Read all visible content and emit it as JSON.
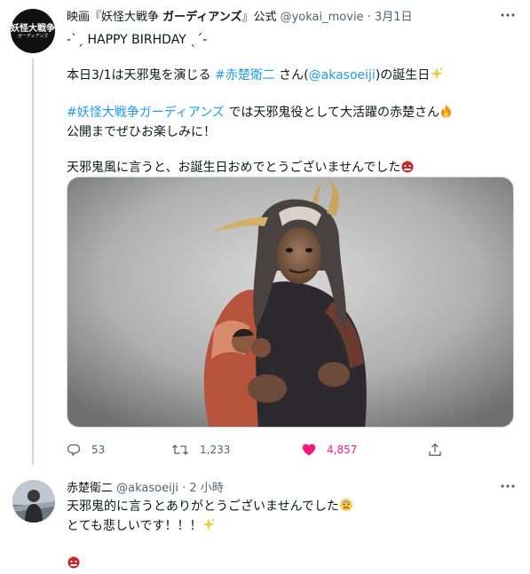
{
  "tweet": {
    "avatar_text": "妖怪大戦争",
    "avatar_subtext": "ガーディアンズ",
    "name_prefix": "映画『妖怪大戦争 ",
    "name_bold": "ガーディアンズ",
    "name_suffix": "』公式",
    "handle": "@yokai_movie",
    "separator": "·",
    "date": "3月1日",
    "line1": "-ˋˏ HAPPY BIRHDAY ˎˊ-",
    "line2_prefix": "本日3/1は天邪鬼を演じる ",
    "line2_hashtag": "#赤楚衛二",
    "line2_mid": " さん(",
    "line2_mention": "@akasoeiji",
    "line2_suffix": ")の誕生日",
    "line3_hashtag": "#妖怪大戦争ガーディアンズ",
    "line3_suffix": " では天邪鬼役として大活躍の赤楚さん",
    "line4": "公開までぜひお楽しみに！",
    "line5": "天邪鬼風に言うと、お誕生日おめでとうございませんでした",
    "reply_count": "53",
    "retweet_count": "1,233",
    "like_count": "4,857"
  },
  "reply": {
    "name": "赤楚衛二",
    "handle": "@akasoeiji",
    "separator": "·",
    "time": "2 小時",
    "line1": "天邪鬼的に言うとありがとうございませんでした",
    "line2": "とても悲しいです！！！"
  },
  "colors": {
    "link": "#1d9bf0",
    "secondary_text": "#536471",
    "like": "#f91880"
  }
}
